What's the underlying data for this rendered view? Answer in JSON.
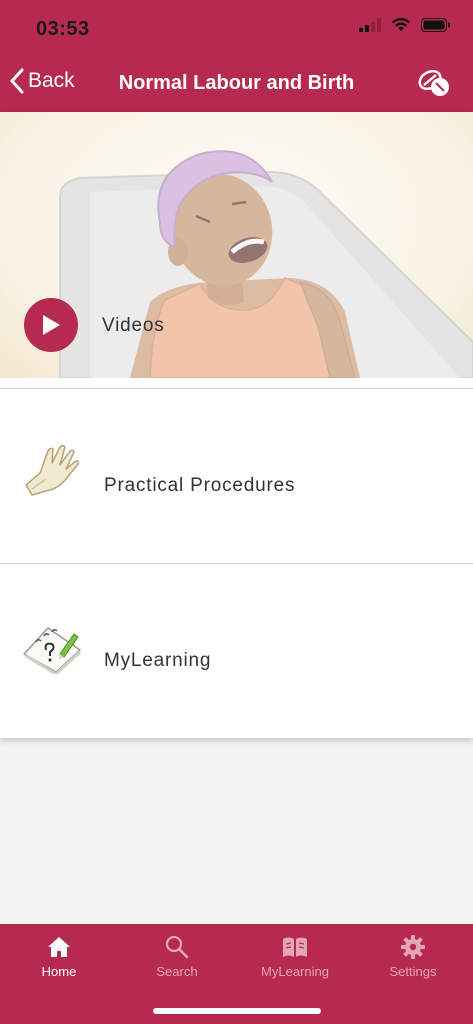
{
  "status_bar": {
    "time": "03:53",
    "icons": [
      "signal-icon",
      "wifi-icon",
      "battery-icon"
    ]
  },
  "nav": {
    "back_label": "Back",
    "title": "Normal Labour and Birth",
    "right_icon": "pill-icon"
  },
  "cards": {
    "videos": {
      "label": "Videos",
      "icon": "play-icon"
    },
    "practical": {
      "label": "Practical Procedures",
      "icon": "glove-icon"
    },
    "mylearning": {
      "label": "MyLearning",
      "icon": "notepad-icon"
    }
  },
  "tabs": [
    {
      "label": "Home",
      "icon": "home-icon",
      "active": true
    },
    {
      "label": "Search",
      "icon": "search-icon",
      "active": false
    },
    {
      "label": "MyLearning",
      "icon": "book-icon",
      "active": false
    },
    {
      "label": "Settings",
      "icon": "gear-icon",
      "active": false
    }
  ],
  "colors": {
    "brand": "#b72a4f",
    "tab_inactive": "#e7a6b7",
    "background": "#f4f4f4"
  }
}
